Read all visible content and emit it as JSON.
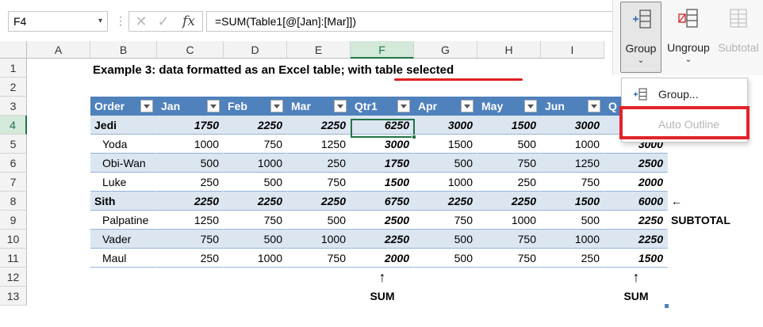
{
  "formula_bar": {
    "name_box": "F4",
    "formula": "=SUM(Table1[@[Jan]:[Mar]])",
    "fx": "fx",
    "cancel": "✕",
    "enter": "✓",
    "dots": "⋮"
  },
  "columns": [
    "A",
    "B",
    "C",
    "D",
    "E",
    "F",
    "G",
    "H",
    "I"
  ],
  "selected_column": "F",
  "rows": [
    "1",
    "2",
    "3",
    "4",
    "5",
    "6",
    "7",
    "8",
    "9",
    "10",
    "11",
    "12",
    "13"
  ],
  "selected_row": "4",
  "title": {
    "text_plain": "Example 3: data formatted as an Excel table; ",
    "text_underlined": "with table selected"
  },
  "table": {
    "headers": [
      "Order",
      "Jan",
      "Feb",
      "Mar",
      "Qtr1",
      "Apr",
      "May",
      "Jun",
      "Q"
    ],
    "rows": [
      [
        "Jedi",
        "1750",
        "2250",
        "2250",
        "6250",
        "3000",
        "1500",
        "3000",
        ""
      ],
      [
        "Yoda",
        "1000",
        "750",
        "1250",
        "3000",
        "1500",
        "500",
        "1000",
        "3000"
      ],
      [
        "Obi-Wan",
        "500",
        "1000",
        "250",
        "1750",
        "500",
        "750",
        "1250",
        "2500"
      ],
      [
        "Luke",
        "250",
        "500",
        "750",
        "1500",
        "1000",
        "250",
        "750",
        "2000"
      ],
      [
        "Sith",
        "2250",
        "2250",
        "2250",
        "6750",
        "2250",
        "2250",
        "1500",
        "6000"
      ],
      [
        "Palpatine",
        "1250",
        "750",
        "500",
        "2500",
        "750",
        "1000",
        "500",
        "2250"
      ],
      [
        "Vader",
        "750",
        "500",
        "1000",
        "2250",
        "500",
        "750",
        "1000",
        "2250"
      ],
      [
        "Maul",
        "250",
        "1000",
        "750",
        "2000",
        "500",
        "750",
        "250",
        "1500"
      ]
    ]
  },
  "annotations": {
    "subtotal": "← SUBTOTAL",
    "sum_f": "SUM",
    "sum_j": "SUM",
    "arrow_up": "↑"
  },
  "ribbon": {
    "group": "Group",
    "ungroup": "Ungroup",
    "subtotal": "Subtotal",
    "caret": "⌄"
  },
  "dropdown": {
    "group_item": "Group...",
    "auto_outline": "Auto Outline"
  },
  "colors": {
    "table_header": "#4f81bd",
    "band": "#dce6f1",
    "selection": "#217346",
    "highlight": "#e2232a"
  }
}
